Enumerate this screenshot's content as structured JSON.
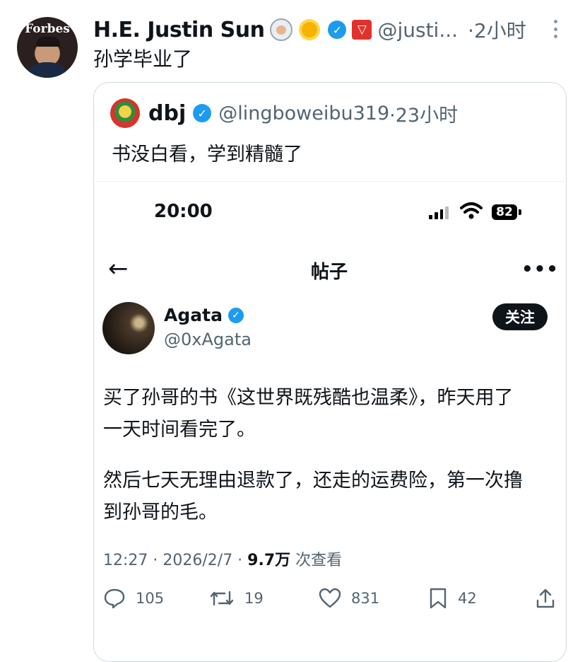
{
  "outer_tweet": {
    "display_name": "H.E. Justin Sun",
    "avatar_text": "Forbes",
    "handle": "@justi...",
    "time": "·2小时",
    "text": "孙学毕业了"
  },
  "quoted_tweet": {
    "display_name": "dbj",
    "handle": "@lingboweibu319",
    "time": "·23小时",
    "text": "书没白看，学到精髓了"
  },
  "screenshot": {
    "status_bar": {
      "clock": "20:00",
      "battery": "82"
    },
    "nav": {
      "title": "帖子",
      "back": "←",
      "more": "•••"
    },
    "author": {
      "name": "Agata",
      "handle": "@0xAgata",
      "follow_label": "关注"
    },
    "post_lines": [
      "买了孙哥的书《这世界既残酷也温柔》，昨天用了",
      "一天时间看完了。",
      "然后七天无理由退款了，还走的运费险，第一次撸",
      "到孙哥的毛。"
    ],
    "meta": {
      "timestamp": "12:27 · 2026/2/7 · ",
      "views": "9.7万",
      "views_label": " 次查看"
    },
    "actions": {
      "replies": "105",
      "reposts": "19",
      "likes": "831",
      "bookmarks": "42"
    }
  },
  "colors": {
    "accent": "#1d9bf0",
    "text": "#0f1419",
    "secondary": "#536471",
    "border": "#cfd9de"
  }
}
